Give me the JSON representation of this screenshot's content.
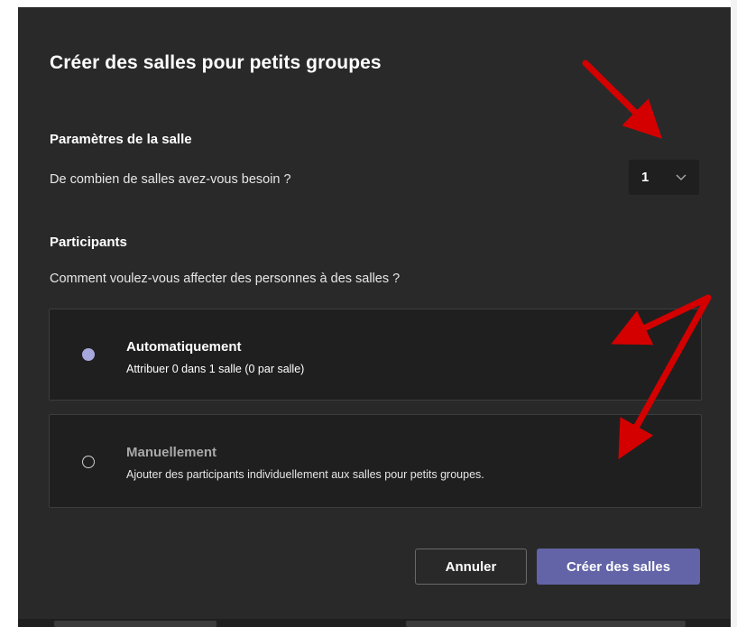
{
  "dialog": {
    "title": "Créer des salles pour petits groupes",
    "background": "#292929"
  },
  "room_settings": {
    "heading": "Paramètres de la salle",
    "question": "De combien de salles avez-vous besoin ?",
    "room_count": "1",
    "dropdown_icon": "chevron-down-icon"
  },
  "participants": {
    "heading": "Participants",
    "question": "Comment voulez-vous affecter des personnes à des salles ?",
    "options": [
      {
        "title": "Automatiquement",
        "description": "Attribuer 0 dans 1 salle (0 par salle)",
        "selected": true
      },
      {
        "title": "Manuellement",
        "description": "Ajouter des participants individuellement aux salles pour petits groupes.",
        "selected": false
      }
    ]
  },
  "actions": {
    "cancel_label": "Annuler",
    "create_label": "Créer des salles"
  },
  "colors": {
    "accent": "#6264a7",
    "radio_selected": "#a6a7dc",
    "annotation_arrow": "#d40000"
  }
}
